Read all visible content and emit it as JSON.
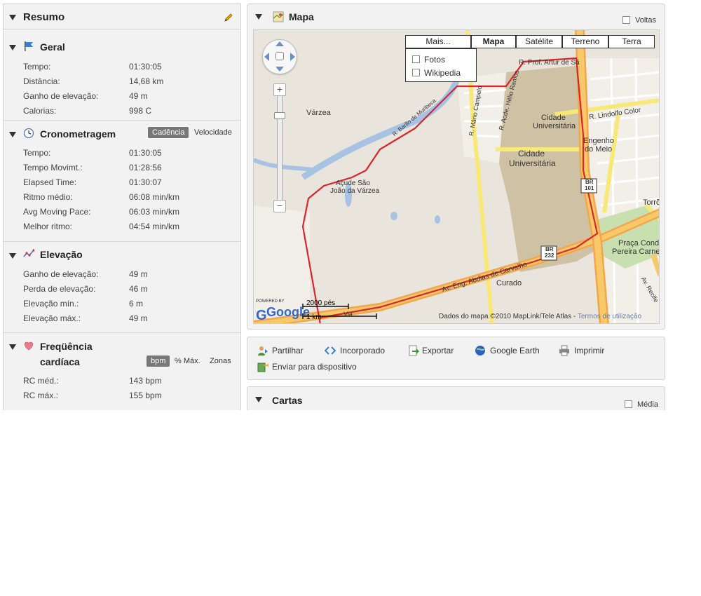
{
  "resumo": {
    "title": "Resumo",
    "geral": {
      "title": "Geral",
      "rows": [
        {
          "label": "Tempo:",
          "value": "01:30:05"
        },
        {
          "label": "Distância:",
          "value": "14,68 km"
        },
        {
          "label": "Ganho de elevação:",
          "value": "49 m"
        },
        {
          "label": "Calorias:",
          "value": "998 C"
        }
      ]
    },
    "crono": {
      "title": "Cronometragem",
      "toggles": [
        "Cadência",
        "Velocidade"
      ],
      "rows": [
        {
          "label": "Tempo:",
          "value": "01:30:05"
        },
        {
          "label": "Tempo Movimt.:",
          "value": "01:28:56"
        },
        {
          "label": "Elapsed Time:",
          "value": "01:30:07"
        },
        {
          "label": "Ritmo médio:",
          "value": "06:08 min/km"
        },
        {
          "label": "Avg Moving Pace:",
          "value": "06:03 min/km"
        },
        {
          "label": "Melhor ritmo:",
          "value": "04:54 min/km"
        }
      ]
    },
    "elevacao": {
      "title": "Elevação",
      "rows": [
        {
          "label": "Ganho de elevação:",
          "value": "49 m"
        },
        {
          "label": "Perda de elevação:",
          "value": "46 m"
        },
        {
          "label": "Elevação mín.:",
          "value": "6 m"
        },
        {
          "label": "Elevação máx.:",
          "value": "49 m"
        }
      ]
    },
    "fc": {
      "title_line1": "Freqüência",
      "title_line2": "cardíaca",
      "toggles": [
        "bpm",
        "% Máx.",
        "Zonas"
      ],
      "rows": [
        {
          "label": "RC méd.:",
          "value": "143 bpm"
        },
        {
          "label": "RC máx.:",
          "value": "155 bpm"
        }
      ]
    }
  },
  "mapa": {
    "title": "Mapa",
    "voltas": "Voltas",
    "mais": "Mais...",
    "types": [
      "Mapa",
      "Satélite",
      "Terreno",
      "Terra"
    ],
    "overlays": [
      "Fotos",
      "Wikipedia"
    ],
    "labels": {
      "varzea": "Várzea",
      "acude1": "Açude São",
      "acude2": "João da Várzea",
      "barao": "R. Barão de Muribeca",
      "campelo": "R. Mário Campelo",
      "ramos": "R. Acde. Hélio Ramos",
      "artur": "R. Prof. Artur de Sá",
      "lindolfo": "R. Lindolfo Color",
      "cid1a": "Cidade",
      "cid1b": "Universitária",
      "cid2a": "Cidade",
      "cid2b": "Universitária",
      "eng1": "Engenho",
      "eng2": "do Meio",
      "torre": "Torrõ",
      "praca1": "Praça Cond",
      "praca2": "Pereira Carne",
      "curado": "Curado",
      "abdias": "Av. Eng. Abdias de Carvalho",
      "recife": "Av. Recife",
      "via": "Via",
      "br101a": "BR",
      "br101b": "101",
      "br232a": "BR",
      "br232b": "232",
      "powered": "POWERED BY",
      "google": "Google",
      "scale_ft": "2000 pés",
      "scale_km": "1 km",
      "copyright": "Dados do mapa ©2010 MapLink/Tele Atlas - ",
      "terms": "Termos de utilização"
    }
  },
  "actions": {
    "partilhar": "Partilhar",
    "incorporado": "Incorporado",
    "exportar": "Exportar",
    "earth": "Google Earth",
    "imprimir": "Imprimir",
    "enviar": "Enviar para dispositivo"
  },
  "cartas": {
    "title": "Cartas",
    "media": "Média"
  }
}
